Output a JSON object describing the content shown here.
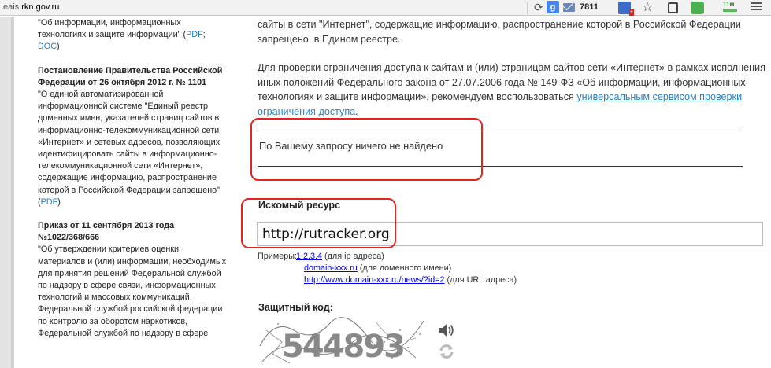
{
  "browser": {
    "url_prefix": "eais.",
    "url_domain": "rkn.gov.ru",
    "mail_count": "7811",
    "ext_badge": "+",
    "ext_speed": "11м"
  },
  "sidebar": {
    "top_text": "\"Об информации, информационных технологиях и защите информации\" (",
    "top_pdf": "PDF",
    "top_sep": "; ",
    "top_doc": "DOC",
    "top_end": ")",
    "block2_title": "Постановление Правительства Российской Федерации от 26 октября 2012 г. № 1101",
    "block2_text": "\"О единой автоматизированной информационной системе \"Единый реестр доменных имен, указателей страниц сайтов в информационно-телекоммуникационной сети «Интернет» и сетевых адресов, позволяющих идентифицировать сайты в информационно-телекоммуникационной сети «Интернет», содержащие информацию, распространение которой в Российской Федерации запрещено\" (",
    "block2_pdf": "PDF",
    "block2_end": ")",
    "block3_title": "Приказ от 11 сентября 2013 года №1022/368/666",
    "block3_text": "\"Об утверждении критериев оценки материалов и (или) информации, необходимых для принятия решений Федеральной службой по надзору в сфере связи, информационных технологий и массовых коммуникаций, Федеральной службой российской федерации по контролю за оборотом наркотиков, Федеральной службой по надзору в сфере"
  },
  "main": {
    "p1": "сайты в сети \"Интернет\", содержащие информацию, распространение которой в Российской Федерации запрещено, в Едином реестре.",
    "p2": "Для проверки ограничения доступа к сайтам и (или) страницам сайтов сети «Интернет» в рамках исполнения иных положений Федерального закона от 27.07.2006 года № 149-ФЗ «Об информации, информационных технологиях и защите информации», рекомендуем воспользоваться ",
    "p2_link": "универсальным сервисом проверки ограничения доступа",
    "p2_end": ".",
    "not_found": "По Вашему запросу ничего не найдено",
    "resource_label": "Искомый ресурс",
    "resource_value": "http://rutracker.org",
    "examples_label": "Примеры:",
    "examples": [
      {
        "link": "1.2.3.4",
        "note": " (для ip адреса)"
      },
      {
        "link": "domain-xxx.ru",
        "note": " (для доменного имени)"
      },
      {
        "link": "http://www.domain-xxx.ru/news/?id=2",
        "note": " (для URL адреса)"
      }
    ],
    "code_label": "Защитный код:",
    "captcha_digits": "544893"
  },
  "colors": {
    "link": "#2a80c8",
    "rule": "#0e3f67",
    "highlight": "#e32222"
  }
}
